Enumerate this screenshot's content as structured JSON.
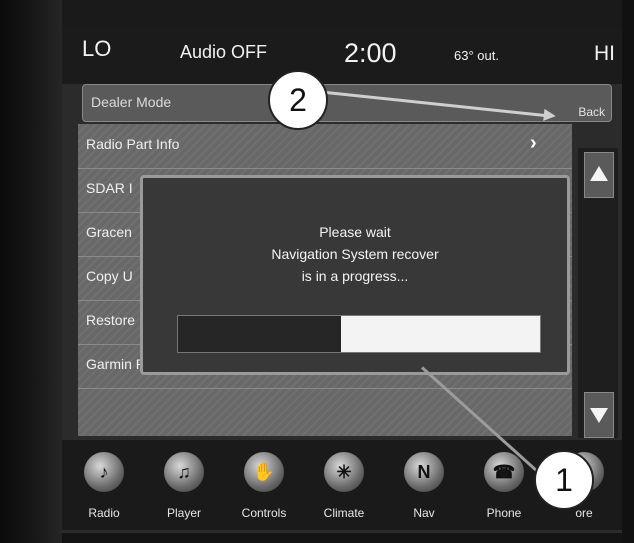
{
  "status_bar": {
    "temp_lo": "LO",
    "audio": "Audio OFF",
    "time": "2:00",
    "outside_temp": "63° out.",
    "temp_hi": "HI"
  },
  "header": {
    "title": "Dealer Mode",
    "back_label": "Back"
  },
  "list": {
    "items": [
      {
        "label": "Radio Part Info",
        "has_chevron": true
      },
      {
        "label": "SDAR I",
        "has_chevron": false
      },
      {
        "label": "Gracen",
        "has_chevron": false
      },
      {
        "label": "Copy U",
        "has_chevron": false
      },
      {
        "label": "Restore",
        "has_chevron": false
      },
      {
        "label": "Garmin Recovery Update",
        "has_chevron": true
      }
    ],
    "chevron": "›"
  },
  "dialog": {
    "line1": "Please wait",
    "line2": "Navigation System recover",
    "line3": "is in a progress...",
    "progress_fraction": 0.45
  },
  "bottom_nav": [
    {
      "label": "Radio",
      "icon": "radio-icon",
      "glyph": "♪"
    },
    {
      "label": "Player",
      "icon": "player-icon",
      "glyph": "♫"
    },
    {
      "label": "Controls",
      "icon": "controls-icon",
      "glyph": "✋"
    },
    {
      "label": "Climate",
      "icon": "climate-icon",
      "glyph": "✳"
    },
    {
      "label": "Nav",
      "icon": "nav-icon",
      "glyph": "N"
    },
    {
      "label": "Phone",
      "icon": "phone-icon",
      "glyph": "☎"
    },
    {
      "label": "ore",
      "icon": "more-icon",
      "glyph": "•"
    }
  ],
  "callouts": {
    "one": "1",
    "two": "2"
  }
}
